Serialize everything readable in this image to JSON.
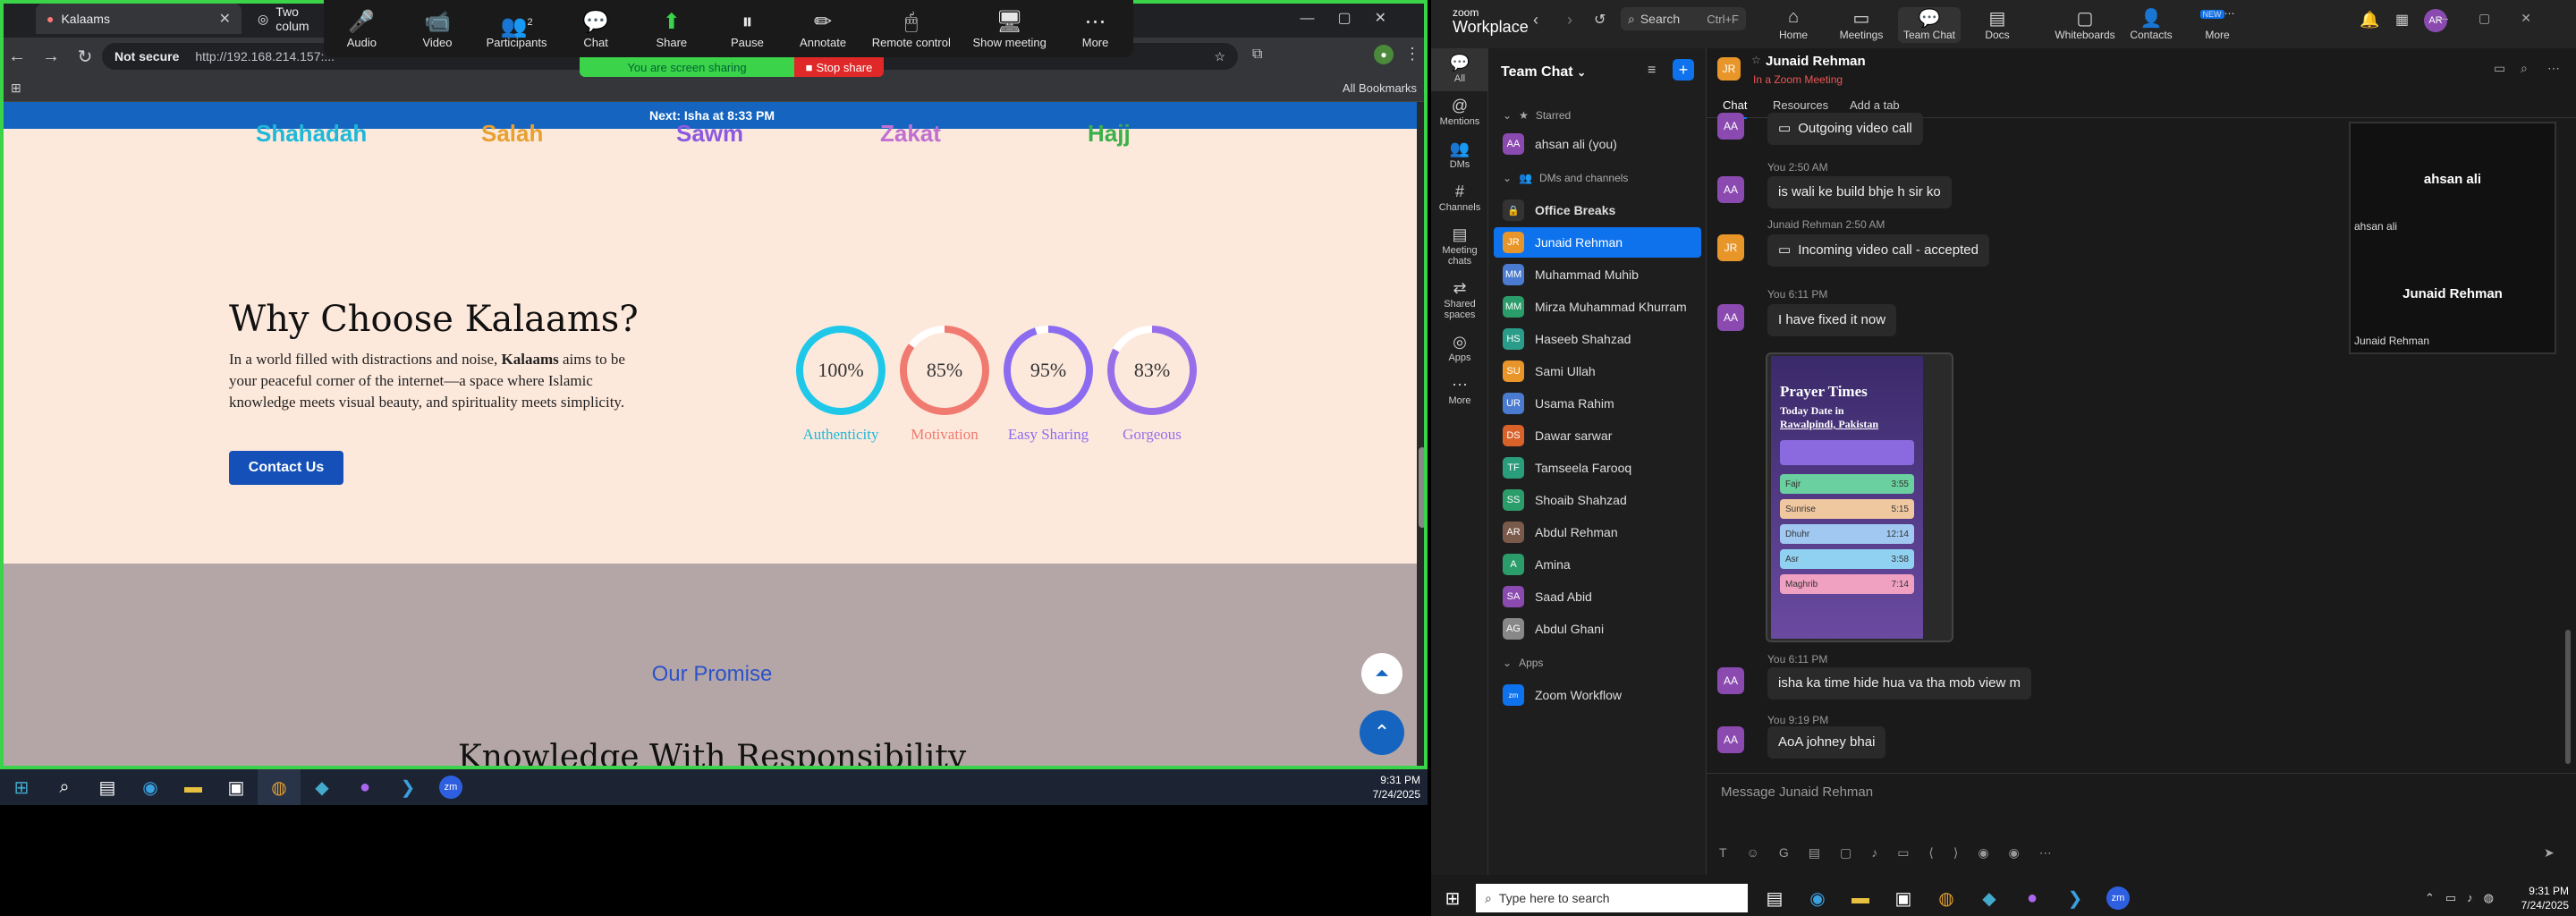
{
  "browser": {
    "tabs": [
      {
        "title": "Kalaams"
      },
      {
        "title": "Two colum"
      }
    ],
    "not_secure": "Not secure",
    "url": "http://192.168.214.157:...",
    "all_bookmarks": "All Bookmarks"
  },
  "zoom_toolbar": {
    "items": [
      {
        "label": "Audio",
        "icon": "🎤"
      },
      {
        "label": "Video",
        "icon": "📹"
      },
      {
        "label": "Participants",
        "icon": "👥",
        "badge": "2"
      },
      {
        "label": "Chat",
        "icon": "💬"
      },
      {
        "label": "Share",
        "icon": "⬆"
      },
      {
        "label": "Pause",
        "icon": "⏸"
      },
      {
        "label": "Annotate",
        "icon": "✏"
      },
      {
        "label": "Remote control",
        "icon": "🖱"
      },
      {
        "label": "Show meeting",
        "icon": "🖥"
      },
      {
        "label": "More",
        "icon": "⋯"
      }
    ],
    "sharing_banner": "You are screen sharing",
    "stop_share": "Stop share"
  },
  "site": {
    "next_prayer": "Next: Isha at 8:33 PM",
    "pillars": [
      "Shahadah",
      "Salah",
      "Sawm",
      "Zakat",
      "Hajj"
    ],
    "why_title": "Why Choose Kalaams?",
    "why_text_1": "In a world filled with distractions and noise,",
    "why_brand": "Kalaams",
    "why_text_2": "aims to be your peaceful corner of the internet—a space where Islamic knowledge meets visual beauty, and spirituality meets simplicity.",
    "contact_btn": "Contact Us",
    "stats": [
      {
        "value": 100,
        "display": "100%",
        "label": "Authenticity",
        "color": "#1fc8e8"
      },
      {
        "value": 85,
        "display": "85%",
        "label": "Motivation",
        "color": "#f07a70"
      },
      {
        "value": 95,
        "display": "95%",
        "label": "Easy Sharing",
        "color": "#8b6cf0"
      },
      {
        "value": 83,
        "display": "83%",
        "label": "Gorgeous",
        "color": "#9a6ee8"
      }
    ],
    "promise_title": "Our Promise",
    "knowledge_title": "Knowledge With Responsibility"
  },
  "left_taskbar": {
    "time": "9:31 PM",
    "date": "7/24/2025"
  },
  "zoom_app": {
    "logo_top": "zoom",
    "logo_bottom": "Workplace",
    "search": "Search",
    "search_shortcut": "Ctrl+F",
    "nav": [
      {
        "label": "Home",
        "icon": "⌂"
      },
      {
        "label": "Meetings",
        "icon": "▭"
      },
      {
        "label": "Team Chat",
        "icon": "💬"
      },
      {
        "label": "Docs",
        "icon": "▤"
      },
      {
        "label": "Whiteboards",
        "icon": "▢"
      },
      {
        "label": "Contacts",
        "icon": "👤"
      },
      {
        "label": "More",
        "icon": "⋯",
        "badge": "NEW"
      }
    ],
    "user_initials": "AR",
    "rail": [
      {
        "label": "All",
        "icon": "💬"
      },
      {
        "label": "Mentions",
        "icon": "@"
      },
      {
        "label": "DMs",
        "icon": "👥"
      },
      {
        "label": "Channels",
        "icon": "#"
      },
      {
        "label": "Meeting chats",
        "icon": "▤"
      },
      {
        "label": "Shared spaces",
        "icon": "⇄"
      },
      {
        "label": "Apps",
        "icon": "◎"
      },
      {
        "label": "More",
        "icon": "⋯"
      }
    ],
    "list_title": "Team Chat",
    "starred": "Starred",
    "self": "ahsan ali (you)",
    "dms_channels": "DMs and channels",
    "office_breaks": "Office Breaks",
    "contacts": [
      {
        "name": "Junaid Rehman",
        "initials": "JR",
        "color": "#e8962a"
      },
      {
        "name": "Muhammad Muhib",
        "initials": "MM",
        "color": "#4a7bd0"
      },
      {
        "name": "Mirza Muhammad Khurram",
        "initials": "MM",
        "color": "#2a9d6a"
      },
      {
        "name": "Haseeb Shahzad",
        "initials": "HS",
        "color": "#2a9d8a"
      },
      {
        "name": "Sami Ullah",
        "initials": "SU",
        "color": "#e8962a"
      },
      {
        "name": "Usama Rahim",
        "initials": "UR",
        "color": "#4a7bd0"
      },
      {
        "name": "Dawar sarwar",
        "initials": "DS",
        "color": "#d8622a"
      },
      {
        "name": "Tamseela Farooq",
        "initials": "TF",
        "color": "#2a9d7a"
      },
      {
        "name": "Shoaib Shahzad",
        "initials": "SS",
        "color": "#2a9d6a"
      },
      {
        "name": "Abdul Rehman",
        "initials": "AR",
        "color": "#7a5a4a"
      },
      {
        "name": "Amina",
        "initials": "A",
        "color": "#2a9d6a"
      },
      {
        "name": "Saad Abid",
        "initials": "SA",
        "color": "#8b4ab0"
      },
      {
        "name": "Abdul Ghani",
        "initials": "AG",
        "color": "#888888"
      }
    ],
    "apps_section": "Apps",
    "zoom_workflow": "Zoom Workflow",
    "chat": {
      "peer": "Junaid Rehman",
      "peer_initials": "JR",
      "status": "In a Zoom Meeting",
      "tabs": [
        "Chat",
        "Resources",
        "Add a tab"
      ],
      "messages": [
        {
          "meta": "",
          "text": "Outgoing video call"
        },
        {
          "meta": "You 2:50 AM",
          "text": "is wali ke build bhje h sir ko"
        },
        {
          "meta": "Junaid Rehman 2:50 AM",
          "text": "Incoming video call - accepted"
        },
        {
          "meta": "You 6:11 PM",
          "text": "I have fixed it now"
        },
        {
          "meta": "You 6:11 PM",
          "text": "isha ka time hide hua va tha mob view m"
        },
        {
          "meta": "You 9:19 PM",
          "text": "AoA johney bhai"
        }
      ],
      "self_initials": "AA",
      "attachment": {
        "title": "Prayer Times",
        "line1": "Today Date in",
        "line2": "Rawalpindi, Pakistan",
        "rows": [
          {
            "name": "Fajr",
            "time": "3:55"
          },
          {
            "name": "Sunrise",
            "time": "5:15"
          },
          {
            "name": "Dhuhr",
            "time": "12:14"
          },
          {
            "name": "Asr",
            "time": "3:58"
          },
          {
            "name": "Maghrib",
            "time": "7:14"
          }
        ]
      },
      "input_placeholder": "Message Junaid Rehman"
    },
    "video_panel": {
      "name1": "ahsan ali",
      "name2": "Junaid Rehman"
    },
    "taskbar": {
      "search": "Type here to search",
      "time": "9:31 PM",
      "date": "7/24/2025"
    }
  }
}
